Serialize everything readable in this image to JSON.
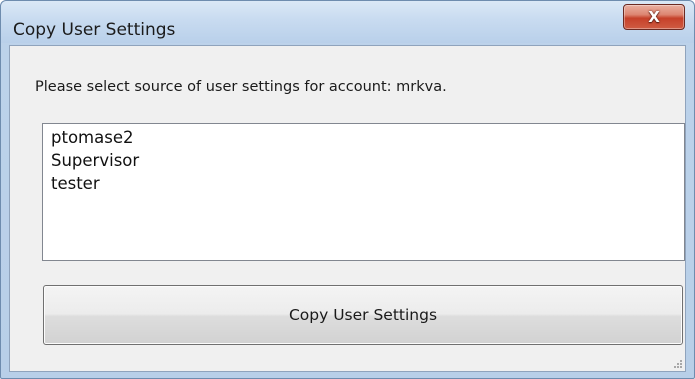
{
  "window": {
    "title": "Copy User Settings",
    "close_label": "X"
  },
  "dialog": {
    "prompt": "Please select source of user settings for account: mrkva.",
    "users": [
      "ptomase2",
      "Supervisor",
      "tester"
    ],
    "copy_button_label": "Copy User Settings"
  },
  "icons": {
    "close": "close-icon",
    "resize": "resize-grip-icon"
  },
  "colors": {
    "titlebar": "#c8dbf0",
    "close_button": "#c6412a",
    "client_background": "#f0f0f0"
  }
}
